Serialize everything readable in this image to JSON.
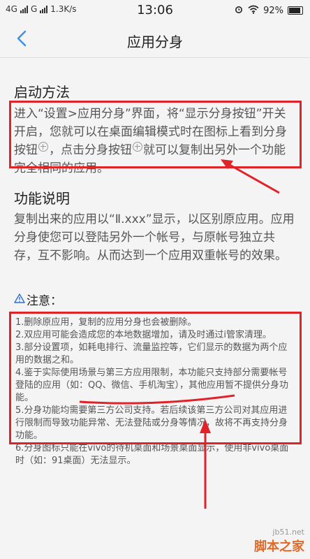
{
  "status_bar": {
    "network1": "4G",
    "network2": "G",
    "speed": "1.3K/s",
    "time": "13:06",
    "battery": "92%"
  },
  "nav": {
    "title": "应用分身",
    "back_icon": "chevron-left-icon"
  },
  "section_launch": {
    "title": "启动方法",
    "text_part1": "进入“设置>应用分身”界面，将“显示分身按钮”开关开启，您就可以在桌面编辑模式时在图标上看到分身按钮",
    "text_part2": "，点击分身按钮",
    "text_part3": "就可以复制出另外一个功能完全相同的应用。"
  },
  "section_function": {
    "title": "功能说明",
    "text": "复制出来的应用以“Ⅱ.xxx”显示，以区别原应用。应用分身使您可以登陆另外一个帐号，与原帐号独立共存，互不影响。从而达到一个应用双重帐号的效果。"
  },
  "notice": {
    "title": "注意：",
    "icon": "warning-icon",
    "items": [
      "1.删除原应用，复制的应用分身也会被删除。",
      "2.双应用可能会造成您的本地数据增加，请及时通过i管家清理。",
      "3.部分设置项，如耗电排行、流量监控等，它们显示的数据为两个应用的数据之和。",
      "4.鉴于实际使用场景与第三方应用限制，本功能只支持部分需要帐号登陆的应用（如：QQ、微信、手机淘宝），其他应用暂不提供分身功能。",
      "5.分身功能均需要第三方公司支持。若后续该第三方公司对其应用进行限制而导致功能异常、无法登陆或分身等情况，故将不再支持分身功能。",
      "6.分身图标只能在vivo的待机桌面和场景桌面显示，使用非vivo桌面时（如：91桌面）无法显示。"
    ]
  },
  "watermark": {
    "url": "jb51.net",
    "brand": "脚本之家"
  },
  "colors": {
    "annotation_red": "#e0232b",
    "back_blue": "#3a8fe6"
  }
}
